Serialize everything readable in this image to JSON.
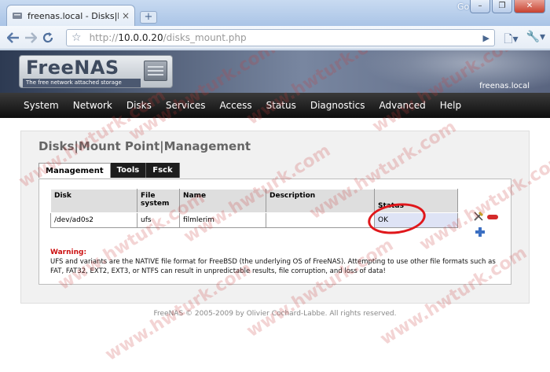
{
  "browser": {
    "tab_title": "freenas.local - Disks|Mount ...",
    "tab_close": "×",
    "new_tab": "+",
    "brand": "Google",
    "url_scheme": "http://",
    "url_host": "10.0.0.20",
    "url_path": "/disks_mount.php",
    "window_buttons": [
      "–",
      "❐",
      "✕"
    ]
  },
  "header": {
    "logo_name": "FreeNAS",
    "logo_tagline": "The free network attached storage",
    "hostname": "freenas.local"
  },
  "menu": [
    "System",
    "Network",
    "Disks",
    "Services",
    "Access",
    "Status",
    "Diagnostics",
    "Advanced",
    "Help"
  ],
  "page": {
    "title": "Disks|Mount Point|Management",
    "tabs": [
      "Management",
      "Tools",
      "Fsck"
    ],
    "active_tab": "Management"
  },
  "table": {
    "headers": {
      "disk": "Disk",
      "fs_line1": "File",
      "fs_line2": "system",
      "name": "Name",
      "description": "Description",
      "status": "Status"
    },
    "rows": [
      {
        "disk": "/dev/ad0s2",
        "filesystem": "ufs",
        "name": "filmlerim",
        "description": "",
        "status": "OK"
      }
    ]
  },
  "warning": {
    "title": "Warning:",
    "text": "UFS and variants are the NATIVE file format for FreeBSD (the underlying OS of FreeNAS). Attempting to use other file formats such as FAT, FAT32, EXT2, EXT3, or NTFS can result in unpredictable results, file corruption, and loss of data!"
  },
  "footer": "FreeNAS © 2005-2009 by Olivier Cochard-Labbe. All rights reserved.",
  "watermark": "www.hwturk.com",
  "colors": {
    "menubar": "#1a1a1a",
    "highlight": "#e0171b",
    "warning": "#cc1111",
    "status_cell": "#dee3f5"
  },
  "icons": {
    "row_edit": "edit-icon",
    "row_delete": "delete-icon",
    "add": "add-icon",
    "bookmark": "star-icon",
    "back": "back-arrow-icon",
    "forward": "forward-arrow-icon",
    "reload": "reload-icon"
  }
}
